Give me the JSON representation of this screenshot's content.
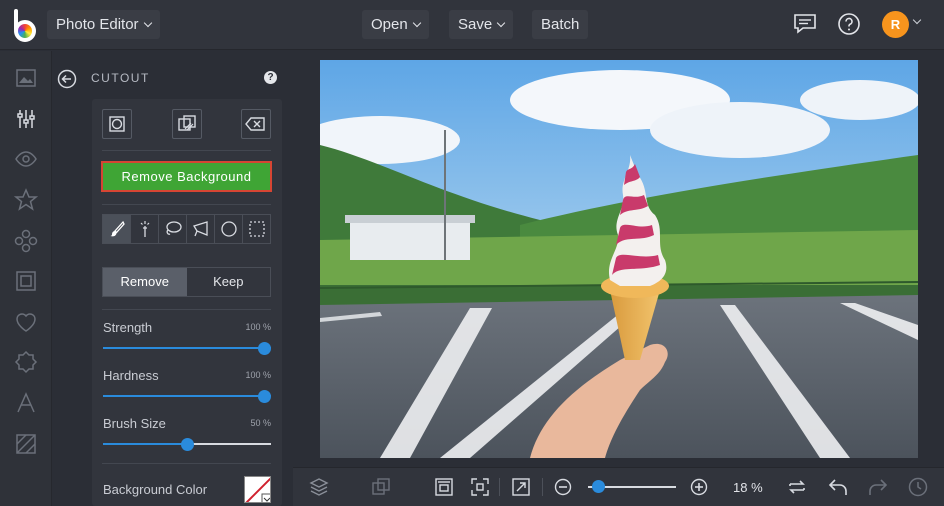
{
  "topbar": {
    "app_menu_label": "Photo Editor",
    "open_label": "Open",
    "save_label": "Save",
    "batch_label": "Batch",
    "avatar_initial": "R"
  },
  "left_rail": {
    "items": [
      "image-icon",
      "sliders-icon",
      "eye-icon",
      "star-icon",
      "flower-icon",
      "frame-icon",
      "heart-icon",
      "badge-icon",
      "text-icon",
      "texture-icon"
    ],
    "active": "sliders-icon"
  },
  "panel": {
    "title": "CUTOUT",
    "help_label": "?",
    "remove_background_label": "Remove Background",
    "mode_remove_label": "Remove",
    "mode_keep_label": "Keep",
    "active_mode": "Remove",
    "strength_label": "Strength",
    "strength_value_text": "100 %",
    "strength_value": 100,
    "hardness_label": "Hardness",
    "hardness_value_text": "100 %",
    "hardness_value": 100,
    "brush_size_label": "Brush Size",
    "brush_size_value_text": "50 %",
    "brush_size_value": 50,
    "background_color_label": "Background Color"
  },
  "bottombar": {
    "zoom_text": "18 %",
    "zoom_fraction": 0.05
  },
  "colors": {
    "accent": "#2a8bdc",
    "primary_button": "#3fa535",
    "highlight_border": "#d64533",
    "avatar": "#f7941d"
  }
}
